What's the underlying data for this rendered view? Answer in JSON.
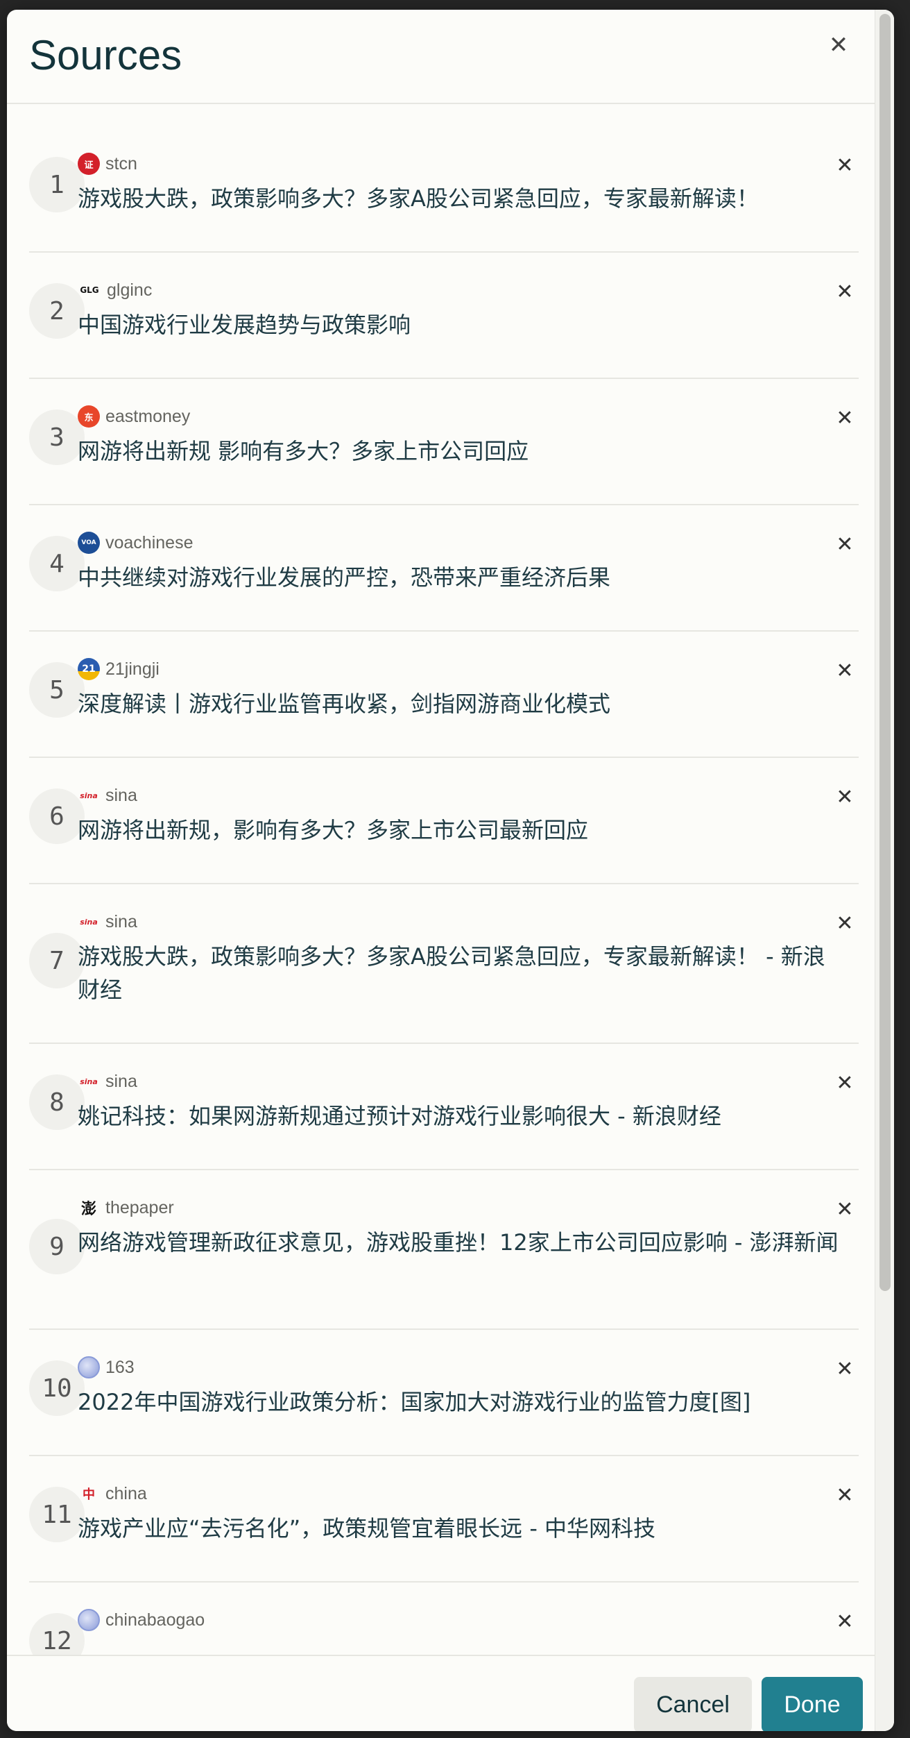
{
  "dialog": {
    "title": "Sources",
    "close_icon": "close-icon"
  },
  "sources": [
    {
      "number": "1",
      "site": "stcn",
      "favicon_color": "#d3202a",
      "favicon_text": "证",
      "title": "游戏股大跌，政策影响多大？多家A股公司紧急回应，专家最新解读！"
    },
    {
      "number": "2",
      "site": "glginc",
      "favicon_color": "#111111",
      "favicon_text": "GLG",
      "title": "中国游戏行业发展趋势与政策影响"
    },
    {
      "number": "3",
      "site": "eastmoney",
      "favicon_color": "#e8462a",
      "favicon_text": "东",
      "title": "网游将出新规 影响有多大？多家上市公司回应"
    },
    {
      "number": "4",
      "site": "voachinese",
      "favicon_color": "#1d4e96",
      "favicon_text": "VOA",
      "title": "中共继续对游戏行业发展的严控，恐带来严重经济后果"
    },
    {
      "number": "5",
      "site": "21jingji",
      "favicon_color": "#2a5db0",
      "favicon_text": "21",
      "title": "深度解读丨游戏行业监管再收紧，剑指网游商业化模式"
    },
    {
      "number": "6",
      "site": "sina",
      "favicon_color": "#ffffff",
      "favicon_text": "sina",
      "title": "网游将出新规，影响有多大？多家上市公司最新回应"
    },
    {
      "number": "7",
      "site": "sina",
      "favicon_color": "#ffffff",
      "favicon_text": "sina",
      "title": "游戏股大跌，政策影响多大？多家A股公司紧急回应，专家最新解读！ - 新浪财经"
    },
    {
      "number": "8",
      "site": "sina",
      "favicon_color": "#ffffff",
      "favicon_text": "sina",
      "title": "姚记科技：如果网游新规通过预计对游戏行业影响很大 - 新浪财经"
    },
    {
      "number": "9",
      "site": "thepaper",
      "favicon_color": "#ffffff",
      "favicon_text": "澎",
      "title": "网络游戏管理新政征求意见，游戏股重挫！12家上市公司回应影响 - 澎湃新闻"
    },
    {
      "number": "10",
      "site": "163",
      "favicon_color": "#8a9bd8",
      "favicon_text": "",
      "title": "2022年中国游戏行业政策分析：国家加大对游戏行业的监管力度[图]"
    },
    {
      "number": "11",
      "site": "china",
      "favicon_color": "#ffffff",
      "favicon_text": "中",
      "title": "游戏产业应“去污名化”，政策规管宜着眼长远 - 中华网科技"
    },
    {
      "number": "12",
      "site": "chinabaogao",
      "favicon_color": "#8a9bd8",
      "favicon_text": "",
      "title": ""
    }
  ],
  "footer": {
    "cancel_label": "Cancel",
    "done_label": "Done"
  },
  "colors": {
    "accent": "#218090",
    "title": "#13343b",
    "background": "#fcfcf9"
  }
}
